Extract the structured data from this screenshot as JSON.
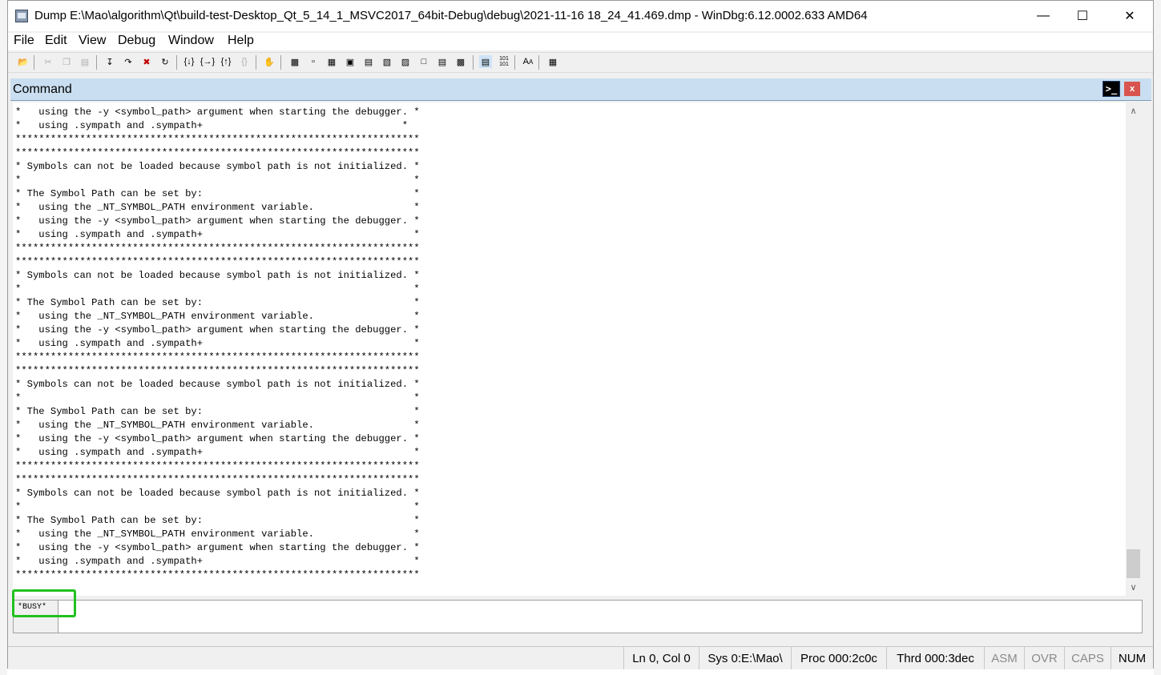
{
  "window": {
    "title": "Dump E:\\Mao\\algorithm\\Qt\\build-test-Desktop_Qt_5_14_1_MSVC2017_64bit-Debug\\debug\\2021-11-16 18_24_41.469.dmp - WinDbg:6.12.0002.633 AMD64",
    "minimize": "—",
    "maximize": "☐",
    "close": "✕"
  },
  "menu": {
    "items": [
      "File",
      "Edit",
      "View",
      "Debug",
      "Window",
      "Help"
    ]
  },
  "toolbar": {
    "icons": [
      "open-icon",
      "cut-icon",
      "copy-icon",
      "paste-icon",
      "source-mode-icon",
      "step-into-icon",
      "step-over-icon",
      "break-icon",
      "restart-icon",
      "step-out-icon",
      "run-to-cursor-icon",
      "go-icon",
      "stop-icon",
      "hand-icon",
      "command-window-icon",
      "watch-window-icon",
      "locals-window-icon",
      "registers-window-icon",
      "memory-window-icon",
      "call-stack-icon",
      "disassembly-window-icon",
      "scratch-pad-icon",
      "processes-icon",
      "source-mode-toggle-icon",
      "hex-mode-icon",
      "font-icon",
      "options-icon"
    ]
  },
  "command": {
    "title": "Command",
    "icon_glyph": ">_",
    "close_glyph": "x",
    "output": "*   using the -y <symbol_path> argument when starting the debugger. *\n*   using .sympath and .sympath+                                  *\n*********************************************************************\n*********************************************************************\n* Symbols can not be loaded because symbol path is not initialized. *\n*                                                                   *\n* The Symbol Path can be set by:                                    *\n*   using the _NT_SYMBOL_PATH environment variable.                 *\n*   using the -y <symbol_path> argument when starting the debugger. *\n*   using .sympath and .sympath+                                    *\n*********************************************************************\n*********************************************************************\n* Symbols can not be loaded because symbol path is not initialized. *\n*                                                                   *\n* The Symbol Path can be set by:                                    *\n*   using the _NT_SYMBOL_PATH environment variable.                 *\n*   using the -y <symbol_path> argument when starting the debugger. *\n*   using .sympath and .sympath+                                    *\n*********************************************************************\n*********************************************************************\n* Symbols can not be loaded because symbol path is not initialized. *\n*                                                                   *\n* The Symbol Path can be set by:                                    *\n*   using the _NT_SYMBOL_PATH environment variable.                 *\n*   using the -y <symbol_path> argument when starting the debugger. *\n*   using .sympath and .sympath+                                    *\n*********************************************************************\n*********************************************************************\n* Symbols can not be loaded because symbol path is not initialized. *\n*                                                                   *\n* The Symbol Path can be set by:                                    *\n*   using the _NT_SYMBOL_PATH environment variable.                 *\n*   using the -y <symbol_path> argument when starting the debugger. *\n*   using .sympath and .sympath+                                    *\n*********************************************************************",
    "prompt": "*BUSY*",
    "input_value": "",
    "scroll_up": "∧",
    "scroll_down": "∨"
  },
  "status": {
    "position": "Ln 0, Col 0",
    "sys": "Sys 0:E:\\Mao\\",
    "proc": "Proc 000:2c0c",
    "thrd": "Thrd 000:3dec",
    "asm": "ASM",
    "ovr": "OVR",
    "caps": "CAPS",
    "num": "NUM"
  },
  "colors": {
    "highlight": "#21c11e",
    "panel_title": "#c9def0"
  }
}
